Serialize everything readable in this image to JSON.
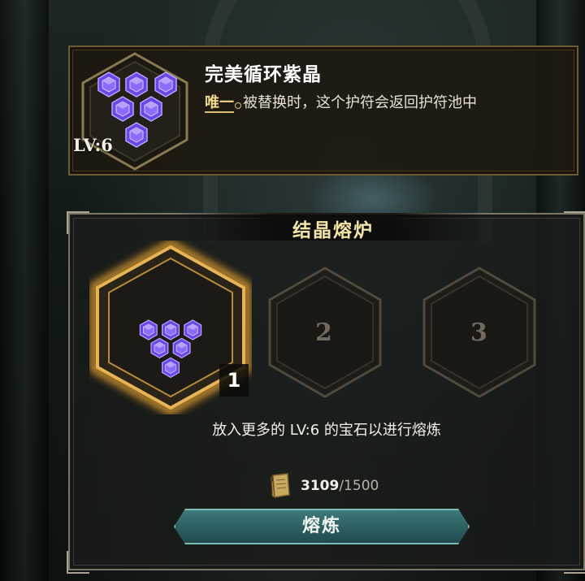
{
  "item": {
    "name": "完美循环紫晶",
    "level": "LV:6",
    "unique_tag": "唯一",
    "description": "被替换时，这个护符会返回护符池中",
    "gem_color": "#7a5cff",
    "gem_icon": "amethyst-cluster-icon"
  },
  "forge": {
    "title": "结晶熔炉",
    "slots": [
      {
        "label": "1",
        "filled": true,
        "count": "1"
      },
      {
        "label": "2",
        "filled": false
      },
      {
        "label": "3",
        "filled": false
      }
    ],
    "hint": "放入更多的 LV:6 的宝石以进行熔炼",
    "cost": {
      "have": "3109",
      "need": "/1500",
      "icon": "scroll-icon"
    },
    "button_label": "熔炼"
  },
  "colors": {
    "accent_gold": "#e0b04a",
    "button_teal": "#2c5e60",
    "title_gold": "#f2e3a6"
  }
}
